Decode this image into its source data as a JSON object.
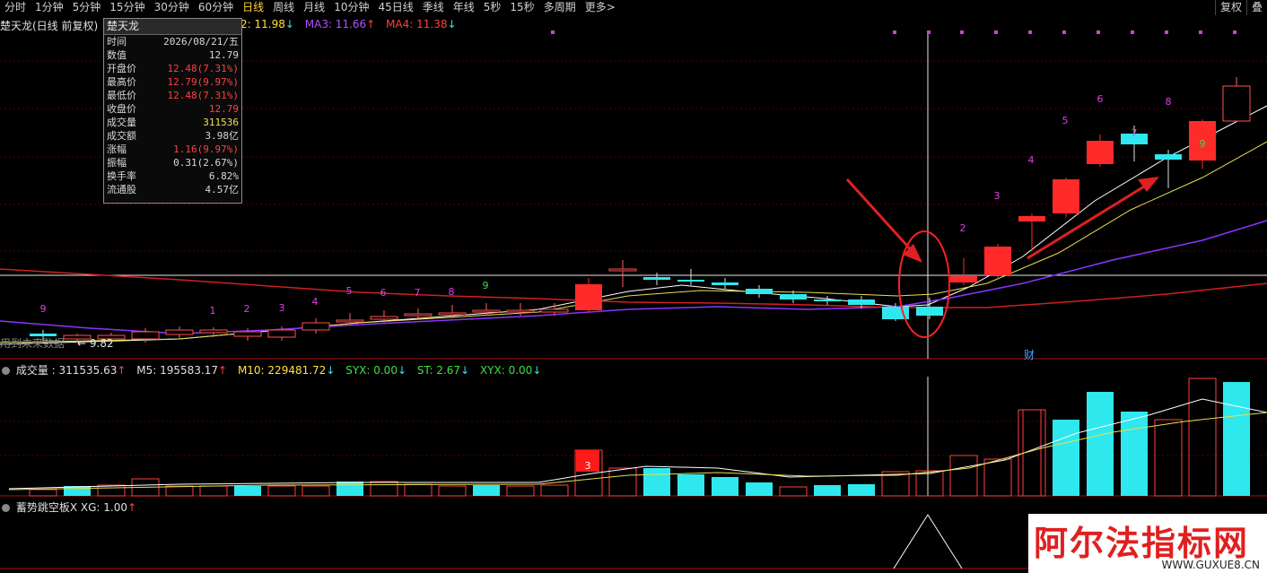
{
  "toolbar": {
    "tabs": [
      "分时",
      "1分钟",
      "5分钟",
      "15分钟",
      "30分钟",
      "60分钟",
      "日线",
      "周线",
      "月线",
      "10分钟",
      "45日线",
      "季线",
      "年线",
      "5秒",
      "15秒",
      "多周期",
      "更多>"
    ],
    "active": "日线",
    "right": [
      "复权",
      "叠"
    ]
  },
  "main": {
    "title": "楚天龙(日线 前复权)",
    "ma2": "2: 11.98",
    "ma3": "MA3: 11.66",
    "ma4": "MA4: 11.38",
    "future_label": "用到未来数据",
    "low_label": "← 9.82",
    "cai_label": "财",
    "colors": {
      "up": "#ff2a2a",
      "down": "#2ee8ee",
      "ma_white": "#ffffff",
      "ma_yellow": "#e8e050",
      "ma_purple": "#8a35ff",
      "ma_red": "#d02020",
      "dot": "#d040d0"
    }
  },
  "info": {
    "title": "楚天龙",
    "rows": [
      {
        "k": "时间",
        "v": "2026/08/21/五",
        "c": ""
      },
      {
        "k": "数值",
        "v": "12.79",
        "c": ""
      },
      {
        "k": "开盘价",
        "v": "12.48(7.31%)",
        "c": "red"
      },
      {
        "k": "最高价",
        "v": "12.79(9.97%)",
        "c": "red"
      },
      {
        "k": "最低价",
        "v": "12.48(7.31%)",
        "c": "red"
      },
      {
        "k": "收盘价",
        "v": "12.79",
        "c": "red"
      },
      {
        "k": "成交量",
        "v": "311536",
        "c": "yel"
      },
      {
        "k": "成交额",
        "v": "3.98亿",
        "c": ""
      },
      {
        "k": "涨幅",
        "v": "1.16(9.97%)",
        "c": "red"
      },
      {
        "k": "振幅",
        "v": "0.31(2.67%)",
        "c": ""
      },
      {
        "k": "换手率",
        "v": "6.82%",
        "c": ""
      },
      {
        "k": "流通股",
        "v": "4.57亿",
        "c": ""
      }
    ]
  },
  "volume": {
    "label": "成交量 : 311535.63",
    "m5": "M5: 195583.17",
    "m10": "M10: 229481.72",
    "syx": "SYX: 0.00",
    "st": "ST: 2.67",
    "xyx": "XYX: 0.00"
  },
  "indicator": {
    "label": "蓄势跳空板X",
    "xg": "XG: 1.00"
  },
  "candle_numbers": [
    "9",
    "1",
    "2",
    "3",
    "4",
    "5",
    "6",
    "7",
    "8",
    "9",
    "2",
    "3",
    "4",
    "5",
    "6",
    "7",
    "8",
    "9"
  ],
  "volume_marker": "3",
  "watermark": {
    "title": "阿尔法指标网",
    "url": "WWW.GUXUE8.CN"
  }
}
